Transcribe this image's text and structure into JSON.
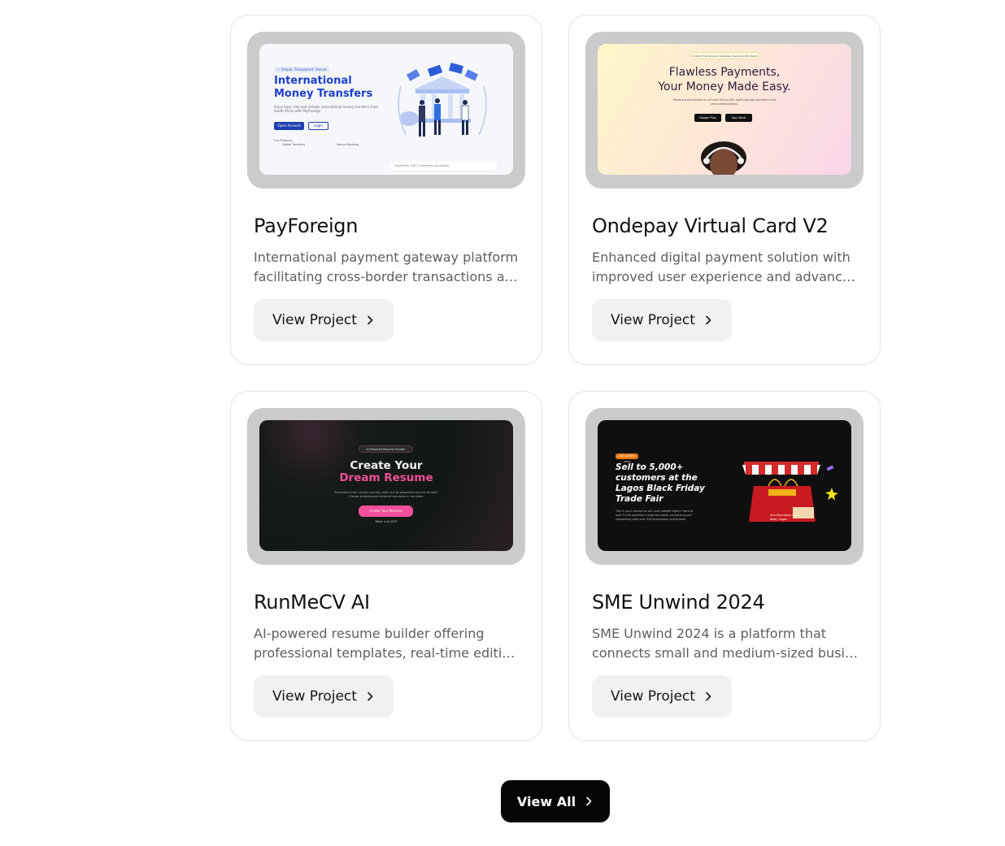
{
  "projects": [
    {
      "title": "PayForeign",
      "desc_line1": "International payment gateway platform",
      "desc_line2": "facilitating cross-border transactions and multi-currency payments",
      "button": "View Project",
      "thumb": {
        "badge": "✓ Simple. Transparent. Secure",
        "heading_line1": "International",
        "heading_line2": "Money Transfers",
        "text": "Enjoy easy, fast and reliable international money transfers from South Africa with PayForeign",
        "primary_btn": "Open Account",
        "secondary_btn": "Login",
        "features_label": "Our Products",
        "feature1": "Global Transfers",
        "feature2": "Secure Banking",
        "footer": "Trusted by 10K+ customers worldwide"
      }
    },
    {
      "title": "Ondepay Virtual Card V2",
      "desc_line1": "Enhanced digital payment solution with",
      "desc_line2": "improved user experience and advanced security features",
      "button": "View Project",
      "thumb": {
        "pill": "Instant Transfers and Seamless Payments Worldwide",
        "heading_line1": "Flawless Payments,",
        "heading_line2": "Your Money Made Easy.",
        "text": "Powering entrepreneurs all over Africa with lightning-fast payments and zero complications.",
        "store1": "Google Play",
        "store2": "App Store"
      }
    },
    {
      "title": "RunMeCV AI",
      "desc_line1": "AI-powered resume builder offering",
      "desc_line2": "professional templates, real-time editing, and smart suggestions",
      "button": "View Project",
      "thumb": {
        "pill": "AI-Powered Resume Builder",
        "heading_line1": "Create Your",
        "heading_line2": "Dream Resume",
        "text": "Transform your career journey with our AI-powered resume builder. Create professional tailored resumes in minutes.",
        "cta": "Create Your Resume",
        "link": "What is AI ATS?"
      }
    },
    {
      "title": "SME Unwind 2024",
      "desc_line1": "SME Unwind 2024 is a platform that",
      "desc_line2": "connects small and medium-sized businesses with customers",
      "button": "View Project",
      "thumb": {
        "tag": "SME UNWIND 2024",
        "heading": "Sell to 5,000+ customers at the Lagos Black Friday Trade Fair",
        "text": "This is your chance to sell your market right in front of over 5,000 potential customers while connecting and networking with over 500 businesses and brands.",
        "event": "2nd December 2024 Ikeja, Lagos"
      }
    }
  ],
  "view_all": "View All"
}
